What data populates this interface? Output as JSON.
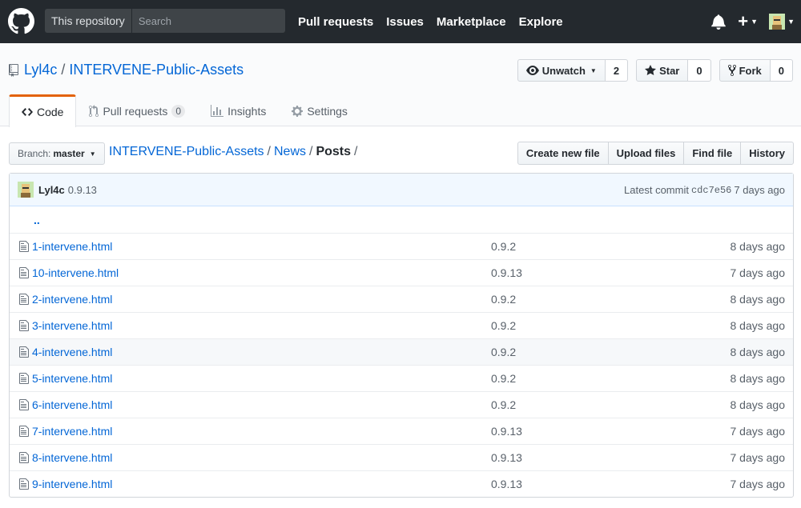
{
  "header": {
    "search_scope": "This repository",
    "search_placeholder": "Search",
    "nav": [
      "Pull requests",
      "Issues",
      "Marketplace",
      "Explore"
    ]
  },
  "repo": {
    "owner": "Lyl4c",
    "name": "INTERVENE-Public-Assets",
    "actions": {
      "watch_label": "Unwatch",
      "watch_count": "2",
      "star_label": "Star",
      "star_count": "0",
      "fork_label": "Fork",
      "fork_count": "0"
    },
    "tabs": {
      "code": "Code",
      "pulls": "Pull requests",
      "pulls_count": "0",
      "insights": "Insights",
      "settings": "Settings"
    }
  },
  "file_nav": {
    "branch_label": "Branch:",
    "branch_value": "master",
    "breadcrumb": {
      "root": "INTERVENE-Public-Assets",
      "dir": "News",
      "current": "Posts",
      "trailing": "/"
    },
    "buttons": [
      "Create new file",
      "Upload files",
      "Find file",
      "History"
    ]
  },
  "commit": {
    "author": "Lyl4c",
    "message": "0.9.13",
    "latest_label": "Latest commit",
    "sha": "cdc7e56",
    "age": "7 days ago"
  },
  "parent_dir": "..",
  "files": [
    {
      "name": "1-intervene.html",
      "message": "0.9.2",
      "age": "8 days ago"
    },
    {
      "name": "10-intervene.html",
      "message": "0.9.13",
      "age": "7 days ago"
    },
    {
      "name": "2-intervene.html",
      "message": "0.9.2",
      "age": "8 days ago"
    },
    {
      "name": "3-intervene.html",
      "message": "0.9.2",
      "age": "8 days ago"
    },
    {
      "name": "4-intervene.html",
      "message": "0.9.2",
      "age": "8 days ago"
    },
    {
      "name": "5-intervene.html",
      "message": "0.9.2",
      "age": "8 days ago"
    },
    {
      "name": "6-intervene.html",
      "message": "0.9.2",
      "age": "8 days ago"
    },
    {
      "name": "7-intervene.html",
      "message": "0.9.13",
      "age": "7 days ago"
    },
    {
      "name": "8-intervene.html",
      "message": "0.9.13",
      "age": "7 days ago"
    },
    {
      "name": "9-intervene.html",
      "message": "0.9.13",
      "age": "7 days ago"
    }
  ],
  "colors": {
    "header_bg": "#24292e",
    "link": "#0366d6",
    "tab_accent": "#e36209",
    "commit_bg": "#f1f8ff"
  },
  "icons": {
    "logo": "github-mark-icon",
    "bell": "bell-icon",
    "plus": "plus-icon",
    "repo": "repo-icon",
    "eye": "eye-icon",
    "star": "star-icon",
    "fork": "fork-icon",
    "code": "code-icon",
    "pr": "pull-request-icon",
    "graph": "graph-icon",
    "gear": "gear-icon",
    "file": "file-icon"
  }
}
